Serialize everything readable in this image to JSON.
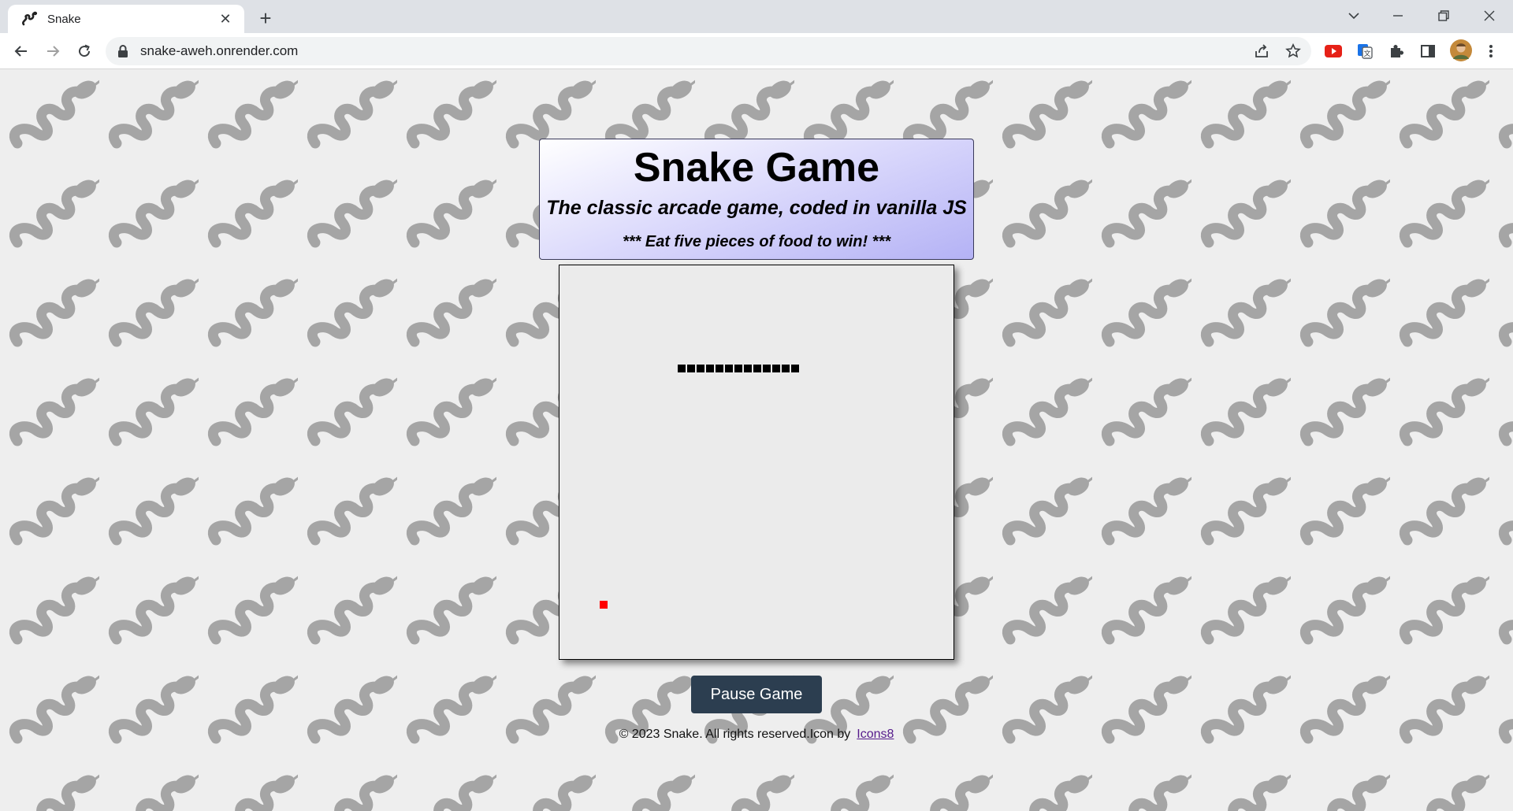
{
  "browser": {
    "tab_title": "Snake",
    "url": "snake-aweh.onrender.com"
  },
  "page": {
    "title": "Snake Game",
    "subtitle": "The classic arcade game, coded in vanilla JS",
    "instruction": "*** Eat five pieces of food to win! ***",
    "pause_label": "Pause Game",
    "footer_text": "© 2023 Snake. All rights reserved.Icon by",
    "footer_link": "Icons8"
  },
  "game": {
    "snake_segments": 13,
    "snake_color": "#000000",
    "food_color": "#ff0000"
  },
  "colors": {
    "pattern": "#a5a5a5",
    "button": "#2c3e50",
    "header_gradient_end": "#b4b2f5"
  }
}
